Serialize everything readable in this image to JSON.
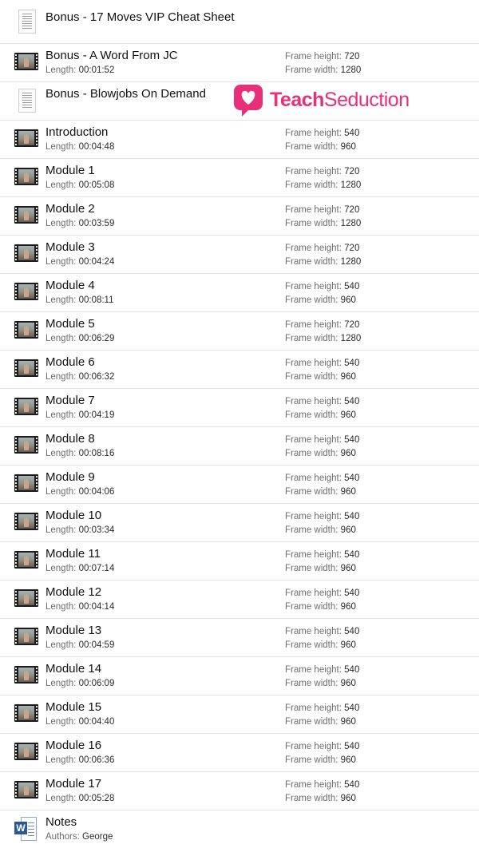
{
  "labels": {
    "length": "Length:",
    "frame_height": "Frame height:",
    "frame_width": "Frame width:",
    "authors": "Authors:"
  },
  "logo": {
    "text_bold": "Teach",
    "text_regular": "Seduction",
    "color": "#e8307a"
  },
  "items": [
    {
      "title": "Bonus - 17 Moves VIP Cheat Sheet",
      "icon": "document-icon"
    },
    {
      "title": "Bonus - A Word From JC",
      "icon": "video-icon",
      "length": "00:01:52",
      "frame_height": "720",
      "frame_width": "1280"
    },
    {
      "title": "Bonus - Blowjobs On Demand",
      "icon": "document-icon"
    },
    {
      "title": "Introduction",
      "icon": "video-icon",
      "length": "00:04:48",
      "frame_height": "540",
      "frame_width": "960"
    },
    {
      "title": "Module 1",
      "icon": "video-icon",
      "length": "00:05:08",
      "frame_height": "720",
      "frame_width": "1280"
    },
    {
      "title": "Module 2",
      "icon": "video-icon",
      "length": "00:03:59",
      "frame_height": "720",
      "frame_width": "1280"
    },
    {
      "title": "Module 3",
      "icon": "video-icon",
      "length": "00:04:24",
      "frame_height": "720",
      "frame_width": "1280"
    },
    {
      "title": "Module 4",
      "icon": "video-icon",
      "length": "00:08:11",
      "frame_height": "540",
      "frame_width": "960"
    },
    {
      "title": "Module 5",
      "icon": "video-icon",
      "length": "00:06:29",
      "frame_height": "720",
      "frame_width": "1280"
    },
    {
      "title": "Module 6",
      "icon": "video-icon",
      "length": "00:06:32",
      "frame_height": "540",
      "frame_width": "960"
    },
    {
      "title": "Module 7",
      "icon": "video-icon",
      "length": "00:04:19",
      "frame_height": "540",
      "frame_width": "960"
    },
    {
      "title": "Module 8",
      "icon": "video-icon",
      "length": "00:08:16",
      "frame_height": "540",
      "frame_width": "960"
    },
    {
      "title": "Module 9",
      "icon": "video-icon",
      "length": "00:04:06",
      "frame_height": "540",
      "frame_width": "960"
    },
    {
      "title": "Module 10",
      "icon": "video-icon",
      "length": "00:03:34",
      "frame_height": "540",
      "frame_width": "960"
    },
    {
      "title": "Module 11",
      "icon": "video-icon",
      "length": "00:07:14",
      "frame_height": "540",
      "frame_width": "960"
    },
    {
      "title": "Module 12",
      "icon": "video-icon",
      "length": "00:04:14",
      "frame_height": "540",
      "frame_width": "960"
    },
    {
      "title": "Module 13",
      "icon": "video-icon",
      "length": "00:04:59",
      "frame_height": "540",
      "frame_width": "960"
    },
    {
      "title": "Module 14",
      "icon": "video-icon",
      "length": "00:06:09",
      "frame_height": "540",
      "frame_width": "960"
    },
    {
      "title": "Module 15",
      "icon": "video-icon",
      "length": "00:04:40",
      "frame_height": "540",
      "frame_width": "960"
    },
    {
      "title": "Module 16",
      "icon": "video-icon",
      "length": "00:06:36",
      "frame_height": "540",
      "frame_width": "960"
    },
    {
      "title": "Module 17",
      "icon": "video-icon",
      "length": "00:05:28",
      "frame_height": "540",
      "frame_width": "960"
    },
    {
      "title": "Notes",
      "icon": "word-document-icon",
      "author": "George"
    }
  ]
}
